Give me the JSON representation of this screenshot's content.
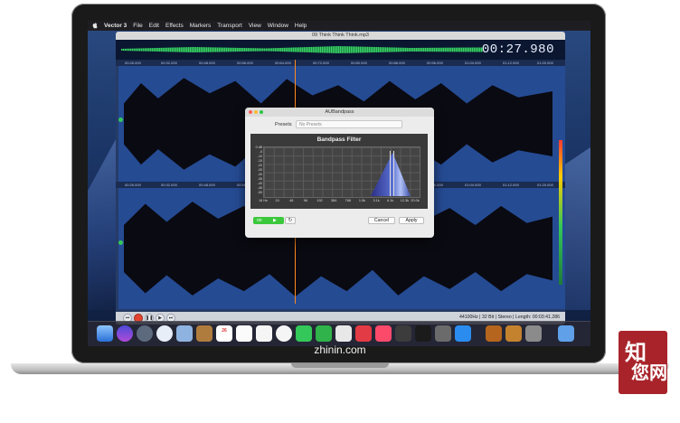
{
  "menubar": {
    "app_name": "Vector 3",
    "items": [
      "File",
      "Edit",
      "Effects",
      "Markers",
      "Transport",
      "View",
      "Window",
      "Help"
    ]
  },
  "window": {
    "title": "09 Think Think Think.mp3",
    "time_display": "00:27.980",
    "ruler_ticks_top": [
      "00:26.000",
      "00:32.000",
      "00:48.000",
      "00:56.000",
      "00:64.000",
      "00:72.000",
      "00:80.000",
      "00:88.000",
      "00:96.000",
      "01:04.000",
      "01:12.000",
      "01:20.000"
    ],
    "ruler_ticks_mid": [
      "00:26.000",
      "00:32.000",
      "00:48.000",
      "00:56.000",
      "00:64.000",
      "00:72.000",
      "00:80.000",
      "00:88.000",
      "00:96.000",
      "01:04.000",
      "01:12.000",
      "01:20.000"
    ],
    "status": "44100Hz | 32 Bit | Stereo | Length: 00:03:41.286"
  },
  "dialog": {
    "title": "AUBandpass",
    "presets_label": "Presets",
    "presets_value": "No Presets",
    "filter_title": "Bandpass Filter",
    "y_labels": [
      "0 dB",
      "-5",
      "-10",
      "-15",
      "-20",
      "-25",
      "-30",
      "-35",
      "-40",
      "-45",
      "-50"
    ],
    "x_labels": [
      "16 Hz",
      "24",
      "48",
      "96",
      "192",
      "384",
      "768",
      "1.5k",
      "3.1k",
      "6.1k",
      "12.3k",
      "20.0k"
    ],
    "cancel_label": "Cancel",
    "apply_label": "Apply",
    "bypass_on": "on",
    "bypass_play": "▶"
  },
  "caption": "zhinin.com",
  "watermark": {
    "line1": "知",
    "line2": "您网"
  },
  "colors": {
    "accent_green": "#3cc83c",
    "playhead": "#ff8a1e",
    "waveform": "#0a0a12"
  }
}
